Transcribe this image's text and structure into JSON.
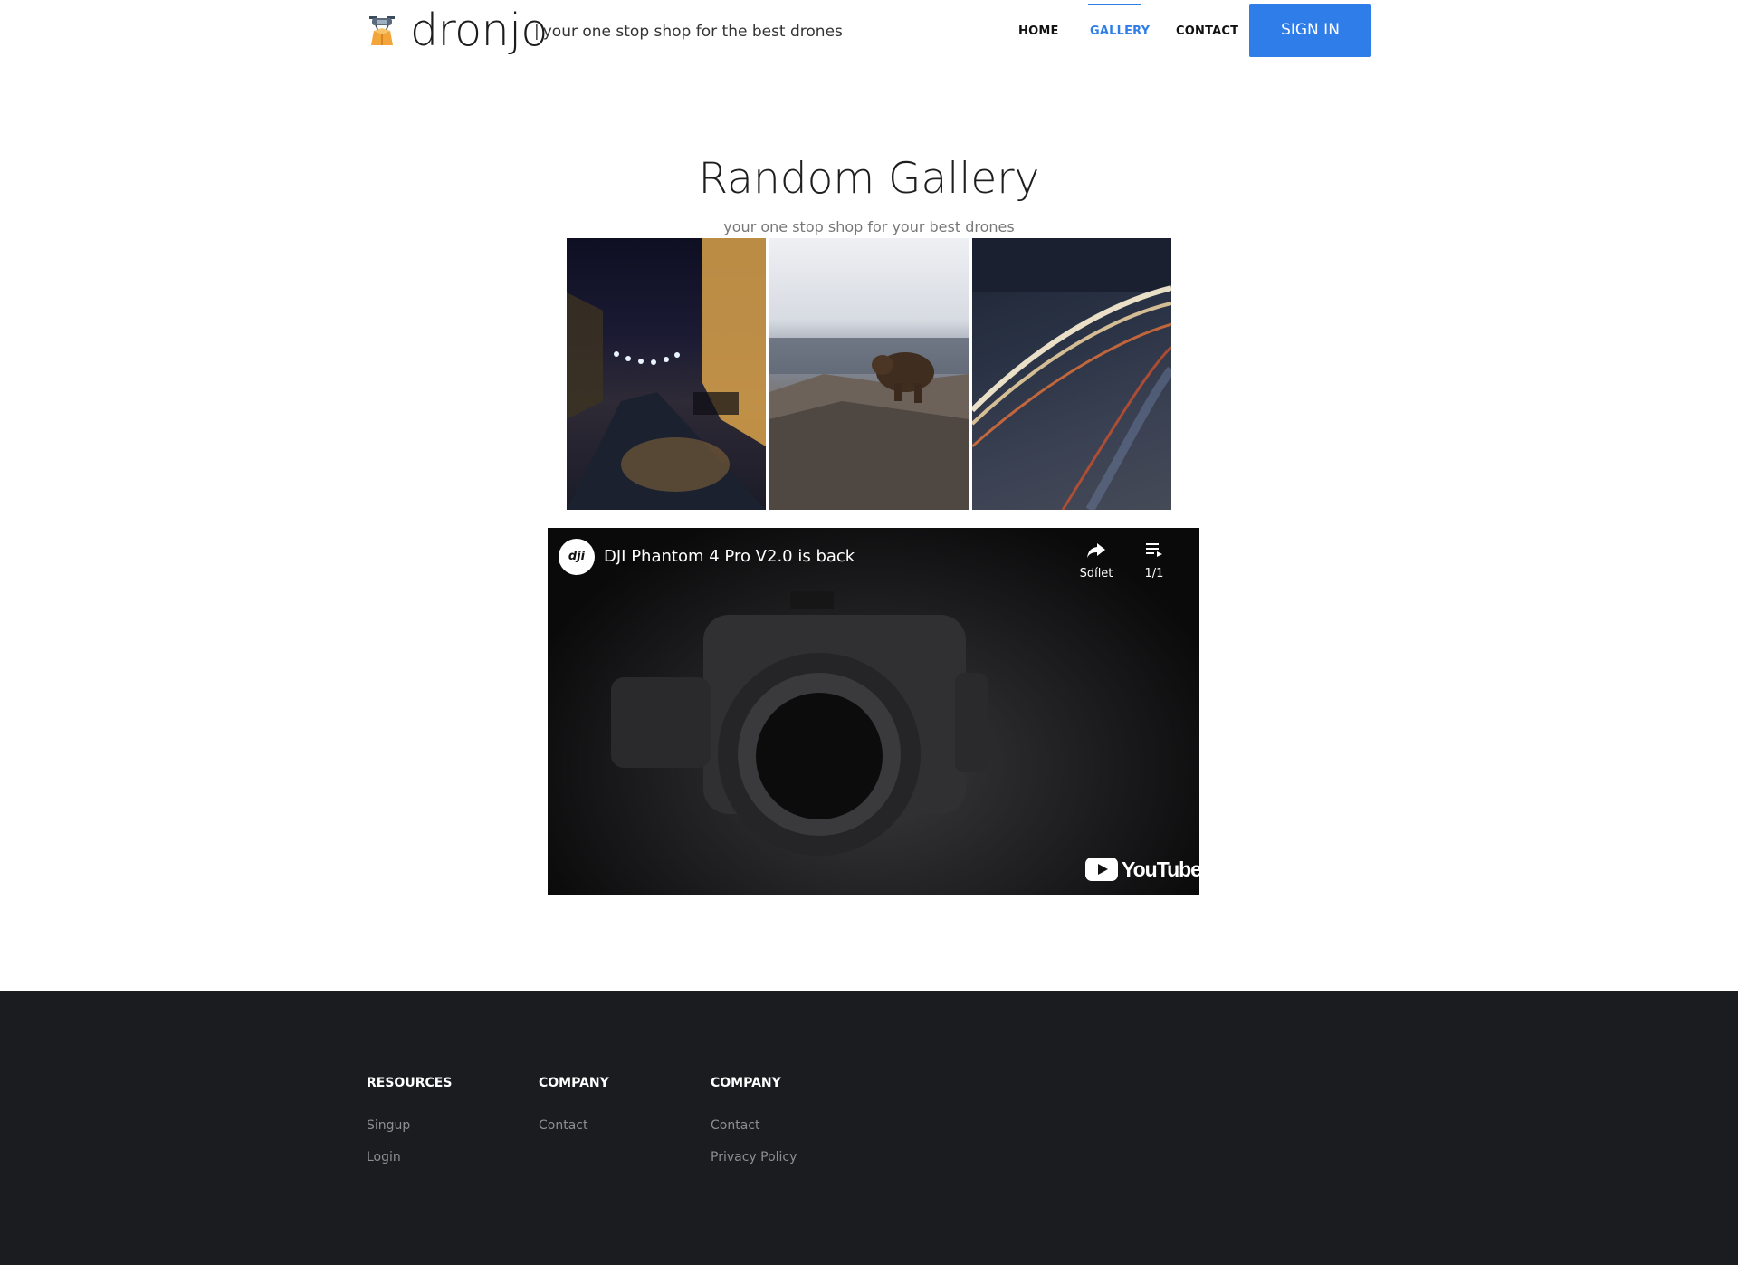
{
  "header": {
    "brand": "dronjo",
    "tagline": "your one stop shop for the best drones",
    "nav": [
      {
        "label": "HOME"
      },
      {
        "label": "GALLERY",
        "active": true
      },
      {
        "label": "CONTACT"
      }
    ],
    "signin_label": "SIGN IN"
  },
  "main": {
    "title": "Random Gallery",
    "subtitle": "your one stop shop for your best drones"
  },
  "video": {
    "title": "DJI Phantom 4 Pro V2.0 is back",
    "channel": "dji",
    "share_label": "Sdílet",
    "playlist_count": "1/1",
    "provider": "YouTube"
  },
  "footer": {
    "columns": [
      {
        "heading": "RESOURCES",
        "links": [
          "Singup",
          "Login"
        ]
      },
      {
        "heading": "COMPANY",
        "links": [
          "Contact"
        ]
      },
      {
        "heading": "COMPANY",
        "links": [
          "Contact",
          "Privacy Policy"
        ]
      }
    ]
  },
  "colors": {
    "accent": "#2f7de8",
    "footer_bg": "#1b1c20",
    "footer_link": "#8d8e93"
  }
}
